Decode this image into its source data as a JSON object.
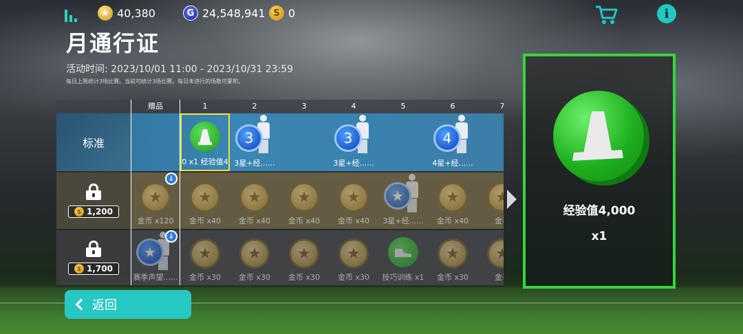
{
  "currency": {
    "star": "40,380",
    "gems": "24,548,941",
    "silver": "0"
  },
  "header": {
    "title": "月通行证",
    "period": "活动时间: 2023/10/01 11:00 - 2023/10/31 23:59",
    "note": "每日上限统计3场比赛。当前可统计3场比赛。每日未进行的场数可累积。"
  },
  "grid": {
    "columns": [
      "赠品",
      "1",
      "2",
      "3",
      "4",
      "5",
      "6",
      "7"
    ],
    "rows": [
      {
        "label": "标准",
        "locked": false
      },
      {
        "label": "",
        "locked": true,
        "price": "1,200"
      },
      {
        "label": "",
        "locked": true,
        "price": "1,700"
      }
    ],
    "standard": [
      "",
      "0 x1   经验值4",
      "3星+经......",
      "",
      "3星+经......",
      "",
      "4星+经......",
      ""
    ],
    "tier1": [
      "金币 x120",
      "金币 x40",
      "金币 x40",
      "金币 x40",
      "金币 x40",
      "3星+经......",
      "金币 x40",
      "金币"
    ],
    "tier2": [
      "赛季声望......",
      "金币 x30",
      "金币 x30",
      "金币 x30",
      "金币 x30",
      "技巧训练 x1",
      "金币 x30",
      "金币"
    ],
    "std_badges": [
      "",
      "",
      "3",
      "",
      "3",
      "",
      "4",
      ""
    ]
  },
  "detail": {
    "name": "经验值4,000",
    "qty": "x1"
  },
  "buttons": {
    "back": "返回"
  },
  "colors": {
    "accent": "#27c7c4",
    "selection": "#35d63a",
    "selected_cell": "#f5e23a"
  }
}
